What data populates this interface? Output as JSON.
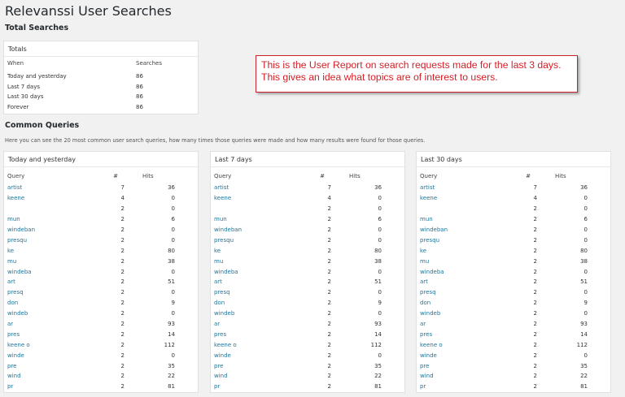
{
  "page": {
    "title": "Relevanssi User Searches"
  },
  "total_searches": {
    "heading": "Total Searches",
    "box_title": "Totals",
    "columns": {
      "when": "When",
      "searches": "Searches"
    },
    "rows": [
      {
        "when": "Today and yesterday",
        "searches": "86"
      },
      {
        "when": "Last 7 days",
        "searches": "86"
      },
      {
        "when": "Last 30 days",
        "searches": "86"
      },
      {
        "when": "Forever",
        "searches": "86"
      }
    ]
  },
  "callout": {
    "text": "This is the User Report on search requests made for the last 3 days. This gives an idea what topics are of interest to users."
  },
  "common_queries": {
    "heading": "Common Queries",
    "description": "Here you can see the 20 most common user search queries, how many times those queries were made and how many results were found for those queries.",
    "columns": {
      "query": "Query",
      "count": "#",
      "hits": "Hits"
    },
    "panels": [
      {
        "title": "Today and yesterday",
        "rows": [
          {
            "q": "artist",
            "n": "7",
            "h": "36"
          },
          {
            "q": "keene",
            "n": "4",
            "h": "0"
          },
          {
            "q": "",
            "n": "2",
            "h": "0"
          },
          {
            "q": "mun",
            "n": "2",
            "h": "6"
          },
          {
            "q": "windeban",
            "n": "2",
            "h": "0"
          },
          {
            "q": "presqu",
            "n": "2",
            "h": "0"
          },
          {
            "q": "ke",
            "n": "2",
            "h": "80"
          },
          {
            "q": "mu",
            "n": "2",
            "h": "38"
          },
          {
            "q": "windeba",
            "n": "2",
            "h": "0"
          },
          {
            "q": "art",
            "n": "2",
            "h": "51"
          },
          {
            "q": "presq",
            "n": "2",
            "h": "0"
          },
          {
            "q": "don",
            "n": "2",
            "h": "9"
          },
          {
            "q": "windeb",
            "n": "2",
            "h": "0"
          },
          {
            "q": "ar",
            "n": "2",
            "h": "93"
          },
          {
            "q": "pres",
            "n": "2",
            "h": "14"
          },
          {
            "q": "keene o",
            "n": "2",
            "h": "112"
          },
          {
            "q": "winde",
            "n": "2",
            "h": "0"
          },
          {
            "q": "pre",
            "n": "2",
            "h": "35"
          },
          {
            "q": "wind",
            "n": "2",
            "h": "22"
          },
          {
            "q": "pr",
            "n": "2",
            "h": "81"
          }
        ]
      },
      {
        "title": "Last 7 days",
        "rows": [
          {
            "q": "artist",
            "n": "7",
            "h": "36"
          },
          {
            "q": "keene",
            "n": "4",
            "h": "0"
          },
          {
            "q": "",
            "n": "2",
            "h": "0"
          },
          {
            "q": "mun",
            "n": "2",
            "h": "6"
          },
          {
            "q": "windeban",
            "n": "2",
            "h": "0"
          },
          {
            "q": "presqu",
            "n": "2",
            "h": "0"
          },
          {
            "q": "ke",
            "n": "2",
            "h": "80"
          },
          {
            "q": "mu",
            "n": "2",
            "h": "38"
          },
          {
            "q": "windeba",
            "n": "2",
            "h": "0"
          },
          {
            "q": "art",
            "n": "2",
            "h": "51"
          },
          {
            "q": "presq",
            "n": "2",
            "h": "0"
          },
          {
            "q": "don",
            "n": "2",
            "h": "9"
          },
          {
            "q": "windeb",
            "n": "2",
            "h": "0"
          },
          {
            "q": "ar",
            "n": "2",
            "h": "93"
          },
          {
            "q": "pres",
            "n": "2",
            "h": "14"
          },
          {
            "q": "keene o",
            "n": "2",
            "h": "112"
          },
          {
            "q": "winde",
            "n": "2",
            "h": "0"
          },
          {
            "q": "pre",
            "n": "2",
            "h": "35"
          },
          {
            "q": "wind",
            "n": "2",
            "h": "22"
          },
          {
            "q": "pr",
            "n": "2",
            "h": "81"
          }
        ]
      },
      {
        "title": "Last 30 days",
        "rows": [
          {
            "q": "artist",
            "n": "7",
            "h": "36"
          },
          {
            "q": "keene",
            "n": "4",
            "h": "0"
          },
          {
            "q": "",
            "n": "2",
            "h": "0"
          },
          {
            "q": "mun",
            "n": "2",
            "h": "6"
          },
          {
            "q": "windeban",
            "n": "2",
            "h": "0"
          },
          {
            "q": "presqu",
            "n": "2",
            "h": "0"
          },
          {
            "q": "ke",
            "n": "2",
            "h": "80"
          },
          {
            "q": "mu",
            "n": "2",
            "h": "38"
          },
          {
            "q": "windeba",
            "n": "2",
            "h": "0"
          },
          {
            "q": "art",
            "n": "2",
            "h": "51"
          },
          {
            "q": "presq",
            "n": "2",
            "h": "0"
          },
          {
            "q": "don",
            "n": "2",
            "h": "9"
          },
          {
            "q": "windeb",
            "n": "2",
            "h": "0"
          },
          {
            "q": "ar",
            "n": "2",
            "h": "93"
          },
          {
            "q": "pres",
            "n": "2",
            "h": "14"
          },
          {
            "q": "keene o",
            "n": "2",
            "h": "112"
          },
          {
            "q": "winde",
            "n": "2",
            "h": "0"
          },
          {
            "q": "pre",
            "n": "2",
            "h": "35"
          },
          {
            "q": "wind",
            "n": "2",
            "h": "22"
          },
          {
            "q": "pr",
            "n": "2",
            "h": "81"
          }
        ]
      }
    ]
  }
}
